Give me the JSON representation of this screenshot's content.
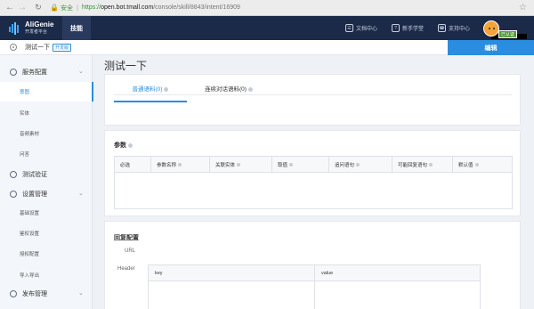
{
  "browser": {
    "secure_label": "安全",
    "url_scheme": "https://",
    "url_host": "open.bot.tmall.com",
    "url_path": "/console/skill/8843/intent/16909"
  },
  "header": {
    "brand_name": "AliGenie",
    "brand_sub": "开发者平台",
    "nav_active": "技能",
    "links": [
      "文档中心",
      "新手学堂",
      "支持中心"
    ],
    "avatar_tag": "已认证"
  },
  "subheader": {
    "skill_name": "测试一下",
    "skill_tag": "开发版",
    "edit_label": "编辑"
  },
  "sidebar": {
    "groups": [
      {
        "label": "服务配置",
        "items": [
          "意图",
          "实体",
          "音频素材",
          "问答"
        ]
      },
      {
        "label": "测试验证",
        "items": []
      },
      {
        "label": "设置管理",
        "items": [
          "基础设置",
          "鉴权设置",
          "授权配置",
          "导入导出"
        ]
      },
      {
        "label": "发布管理",
        "items": []
      }
    ]
  },
  "main": {
    "title": "测试一下",
    "tabs": [
      "普通语料(0)",
      "连续对话语料(0)"
    ],
    "params_title": "参数",
    "params_columns": [
      "必选",
      "参数名称",
      "关联实体",
      "取值",
      "追问语句",
      "可能回复语句",
      "默认值"
    ],
    "reply_title": "回复配置",
    "url_label": "URL",
    "header_label": "Header",
    "header_columns": [
      "key",
      "value"
    ]
  },
  "colors": {
    "accent": "#2a8de0",
    "topnav": "#1b2a48"
  }
}
